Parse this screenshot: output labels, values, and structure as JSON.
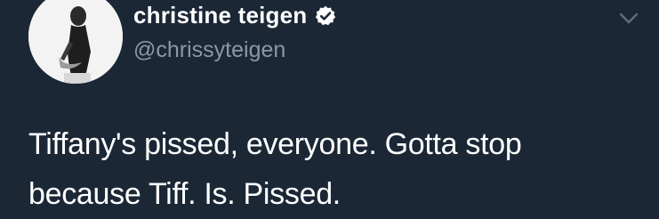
{
  "tweet": {
    "author": {
      "display_name": "christine teigen",
      "handle": "@chrissyteigen",
      "verified_icon": "verified-badge-icon",
      "avatar_icon": "profile-photo"
    },
    "menu_icon": "chevron-down-icon",
    "text_lines": [
      "Tiffany's pissed, everyone. Gotta stop",
      "because Tiff. Is. Pissed."
    ]
  },
  "colors": {
    "background": "#1b2735",
    "text": "#ffffff",
    "secondary_text": "#8899a6",
    "verified_badge": "#ffffff"
  }
}
